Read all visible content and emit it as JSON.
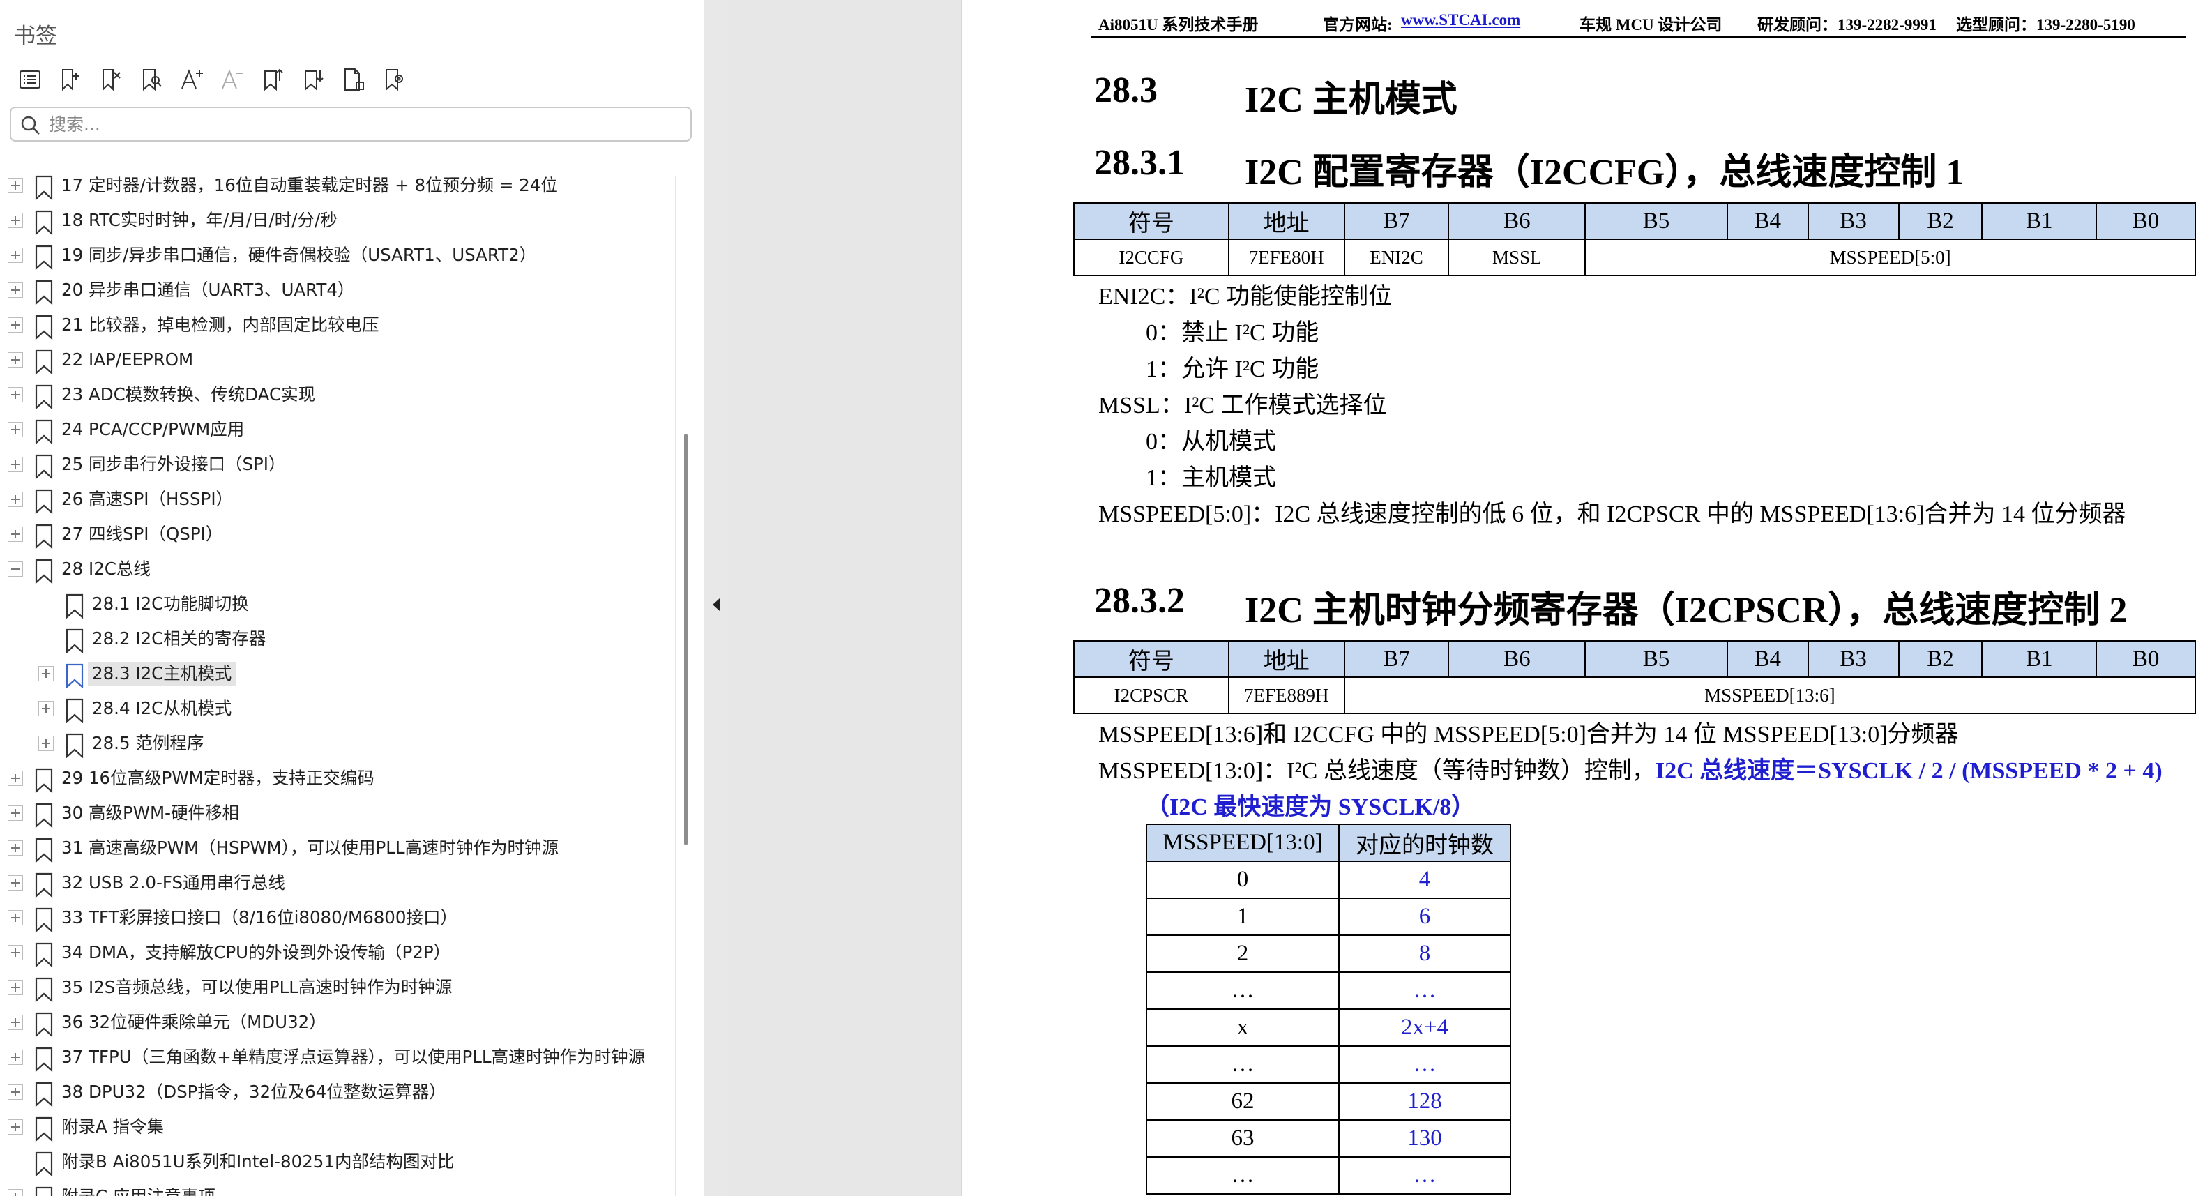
{
  "pane": {
    "title": "书签",
    "search_placeholder": "搜索...",
    "toolbar": [
      {
        "icon": "bookmark-list-icon"
      },
      {
        "icon": "add-bookmark-icon"
      },
      {
        "icon": "delete-bookmark-icon"
      },
      {
        "icon": "find-bookmark-icon"
      },
      {
        "icon": "font-increase-icon"
      },
      {
        "icon": "font-decrease-icon"
      },
      {
        "icon": "expand-all-icon"
      },
      {
        "icon": "collapse-all-icon"
      },
      {
        "icon": "bookmark-properties-icon"
      },
      {
        "icon": "bookmark-settings-icon"
      }
    ],
    "items": [
      {
        "label": "17  定时器/计数器，16位自动重装载定时器 + 8位预分频 = 24位",
        "level": 0,
        "expander": "plus"
      },
      {
        "label": "18  RTC实时时钟，年/月/日/时/分/秒",
        "level": 0,
        "expander": "plus"
      },
      {
        "label": "19  同步/异步串口通信，硬件奇偶校验（USART1、USART2）",
        "level": 0,
        "expander": "plus"
      },
      {
        "label": "20  异步串口通信（UART3、UART4）",
        "level": 0,
        "expander": "plus"
      },
      {
        "label": "21  比较器，掉电检测，内部固定比较电压",
        "level": 0,
        "expander": "plus"
      },
      {
        "label": "22  IAP/EEPROM",
        "level": 0,
        "expander": "plus"
      },
      {
        "label": "23  ADC模数转换、传统DAC实现",
        "level": 0,
        "expander": "plus"
      },
      {
        "label": "24  PCA/CCP/PWM应用",
        "level": 0,
        "expander": "plus"
      },
      {
        "label": "25  同步串行外设接口（SPI）",
        "level": 0,
        "expander": "plus"
      },
      {
        "label": "26  高速SPI（HSSPI）",
        "level": 0,
        "expander": "plus"
      },
      {
        "label": "27  四线SPI（QSPI）",
        "level": 0,
        "expander": "plus"
      },
      {
        "label": "28  I2C总线",
        "level": 0,
        "expander": "minus"
      },
      {
        "label": "28.1  I2C功能脚切换",
        "level": 1,
        "expander": "none"
      },
      {
        "label": "28.2  I2C相关的寄存器",
        "level": 1,
        "expander": "none"
      },
      {
        "label": "28.3  I2C主机模式",
        "level": 1,
        "expander": "plus",
        "selected": true
      },
      {
        "label": "28.4  I2C从机模式",
        "level": 1,
        "expander": "plus"
      },
      {
        "label": "28.5  范例程序",
        "level": 1,
        "expander": "plus"
      },
      {
        "label": "29  16位高级PWM定时器，支持正交编码",
        "level": 0,
        "expander": "plus"
      },
      {
        "label": "30  高级PWM-硬件移相",
        "level": 0,
        "expander": "plus"
      },
      {
        "label": "31  高速高级PWM（HSPWM），可以使用PLL高速时钟作为时钟源",
        "level": 0,
        "expander": "plus"
      },
      {
        "label": "32  USB 2.0-FS通用串行总线",
        "level": 0,
        "expander": "plus"
      },
      {
        "label": "33  TFT彩屏接口接口（8/16位i8080/M6800接口）",
        "level": 0,
        "expander": "plus"
      },
      {
        "label": "34  DMA，支持解放CPU的外设到外设传输（P2P）",
        "level": 0,
        "expander": "plus"
      },
      {
        "label": "35  I2S音频总线，可以使用PLL高速时钟作为时钟源",
        "level": 0,
        "expander": "plus"
      },
      {
        "label": "36  32位硬件乘除单元（MDU32）",
        "level": 0,
        "expander": "plus"
      },
      {
        "label": "37  TFPU（三角函数+单精度浮点运算器），可以使用PLL高速时钟作为时钟源",
        "level": 0,
        "expander": "plus"
      },
      {
        "label": "38  DPU32（DSP指令，32位及64位整数运算器）",
        "level": 0,
        "expander": "plus"
      },
      {
        "label": "附录A  指令集",
        "level": 0,
        "expander": "plus"
      },
      {
        "label": "附录B  Ai8051U系列和Intel-80251内部结构图对比",
        "level": 0,
        "expander": "none"
      },
      {
        "label": "附录C  应用注意事项",
        "level": 0,
        "expander": "plus"
      }
    ]
  },
  "doc": {
    "header": {
      "left": "Ai8051U 系列技术手册",
      "site_label": "官方网站: ",
      "site_link": "www.STCAI.com",
      "company": "车规 MCU 设计公司",
      "advisor": "研发顾问：139-2282-9991",
      "selection": "选型顾问：139-2280-5190"
    },
    "h_283": {
      "num": "28.3",
      "text": "I2C 主机模式"
    },
    "h_2831": {
      "num": "28.3.1",
      "text": "I2C 配置寄存器（I2CCFG），总线速度控制 1"
    },
    "table1": {
      "head": [
        "符号",
        "地址",
        "B7",
        "B6",
        "B5",
        "B4",
        "B3",
        "B2",
        "B1",
        "B0"
      ],
      "row": {
        "symbol": "I2CCFG",
        "addr": "7EFE80H",
        "b7": "ENI2C",
        "b6": "MSSL",
        "rest": "MSSPEED[5:0]"
      }
    },
    "desc1": [
      "ENI2C：I²C 功能使能控制位",
      "0：禁止 I²C 功能",
      "1：允许 I²C 功能",
      "MSSL：I²C 工作模式选择位",
      "0：从机模式",
      "1：主机模式",
      "MSSPEED[5:0]：I2C 总线速度控制的低 6 位，和 I2CPSCR 中的 MSSPEED[13:6]合并为 14 位分频器"
    ],
    "h_2832": {
      "num": "28.3.2",
      "text": "I2C 主机时钟分频寄存器（I2CPSCR），总线速度控制 2"
    },
    "table2": {
      "head": [
        "符号",
        "地址",
        "B7",
        "B6",
        "B5",
        "B4",
        "B3",
        "B2",
        "B1",
        "B0"
      ],
      "row": {
        "symbol": "I2CPSCR",
        "addr": "7EFE889H",
        "rest": "MSSPEED[13:6]"
      }
    },
    "desc2_line1": "MSSPEED[13:6]和 I2CCFG 中的 MSSPEED[5:0]合并为 14 位 MSSPEED[13:0]分频器",
    "desc2_line2_plain": "MSSPEED[13:0]：I²C 总线速度（等待时钟数）控制，",
    "desc2_line2_blue": "I2C 总线速度＝SYSCLK / 2 / (MSSPEED * 2 + 4)",
    "desc2_line3_blue": "（I2C 最快速度为 SYSCLK/8）",
    "clock_table": {
      "head": [
        "MSSPEED[13:0]",
        "对应的时钟数"
      ],
      "rows": [
        [
          "0",
          "4"
        ],
        [
          "1",
          "6"
        ],
        [
          "2",
          "8"
        ],
        [
          "…",
          "…"
        ],
        [
          "x",
          "2x+4"
        ],
        [
          "…",
          "…"
        ],
        [
          "62",
          "128"
        ],
        [
          "63",
          "130"
        ],
        [
          "…",
          "…"
        ]
      ]
    },
    "colors": {
      "table_head": "#c6d9f1",
      "blue_text": "#1f1fd0",
      "link": "#1a1acc"
    }
  }
}
